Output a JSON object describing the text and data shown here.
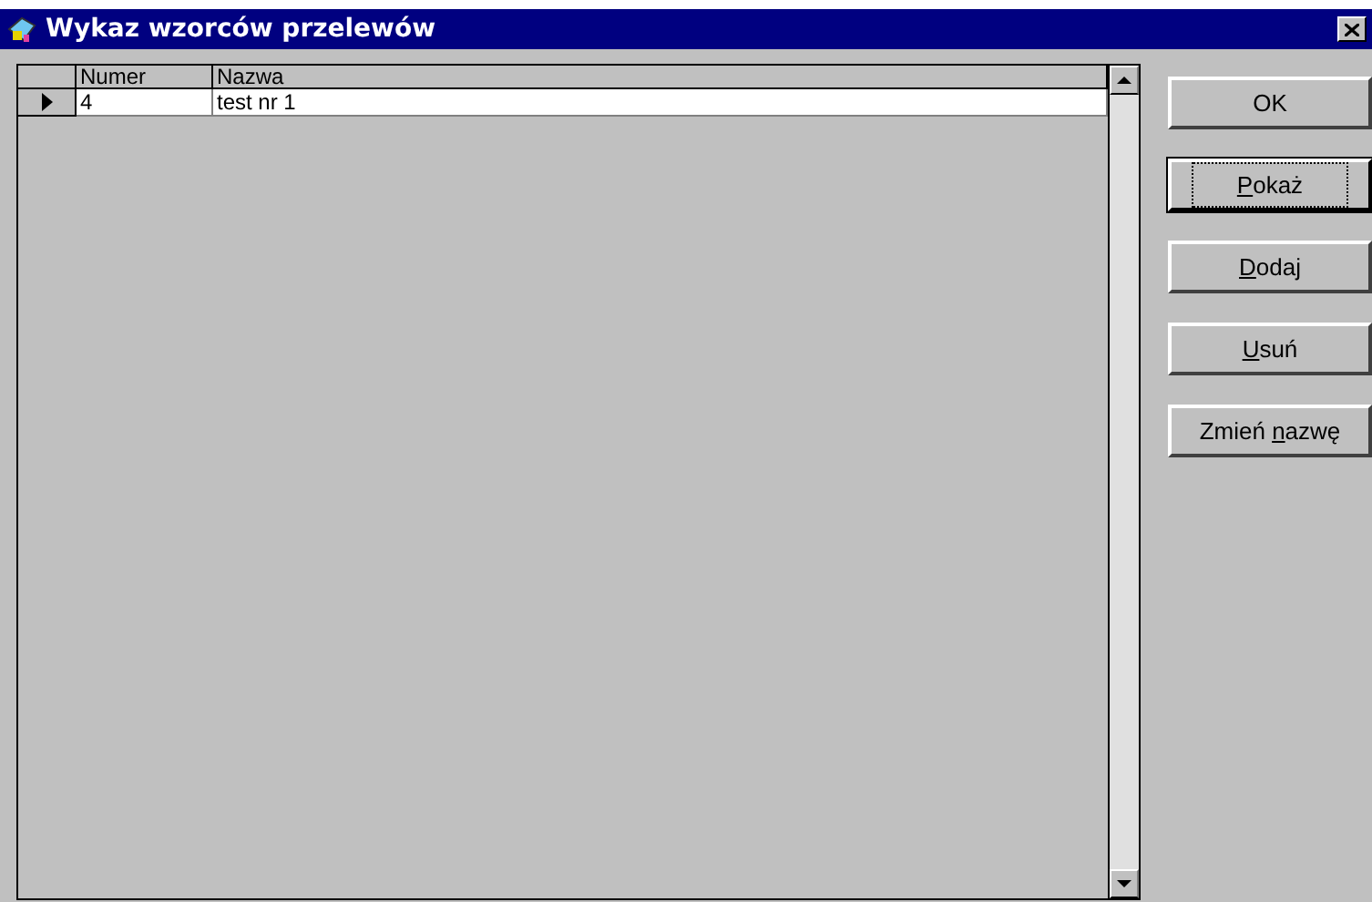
{
  "window": {
    "title": "Wykaz wzorców przelewów"
  },
  "table": {
    "columns": [
      "Numer",
      "Nazwa"
    ],
    "rows": [
      {
        "cells": [
          "4",
          "test nr 1"
        ],
        "current": true
      }
    ]
  },
  "buttons": [
    {
      "before": "OK",
      "focused": false
    },
    {
      "key": "P",
      "after": "okaż",
      "focused": true
    },
    {
      "key": "D",
      "after": "odaj",
      "focused": false
    },
    {
      "key": "U",
      "after": "suń",
      "focused": false
    },
    {
      "before": "Zmień ",
      "key": "n",
      "after": "azwę",
      "focused": false
    }
  ]
}
